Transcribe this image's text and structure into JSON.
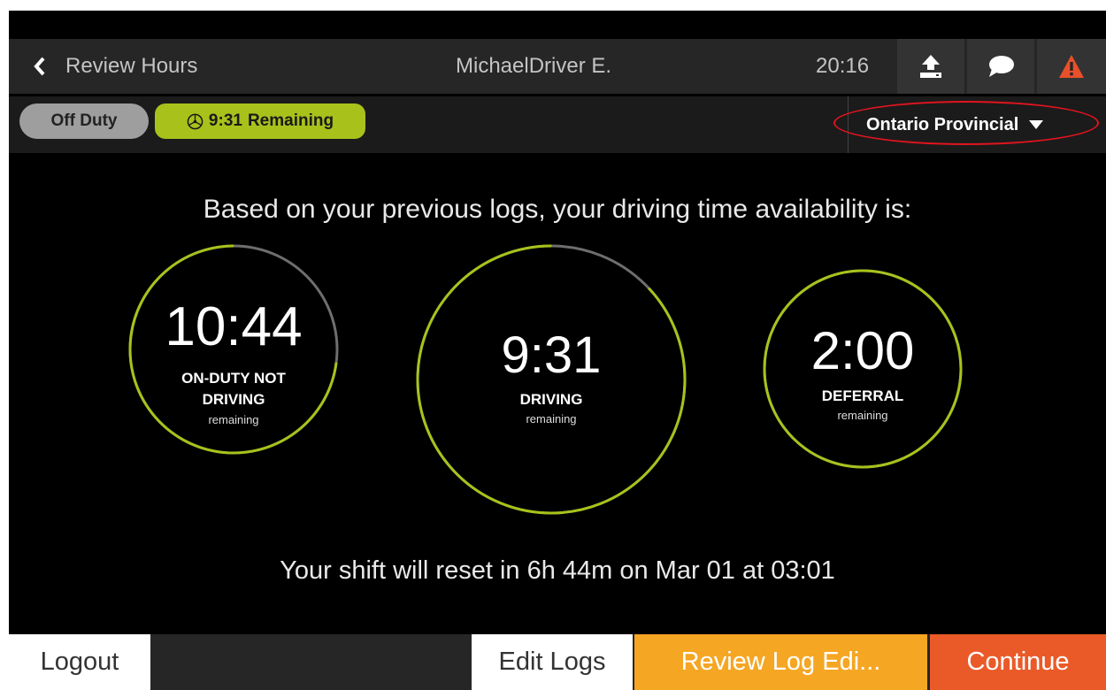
{
  "header": {
    "back_label": "Review Hours",
    "driver_name": "MichaelDriver E.",
    "time": "20:16",
    "icons": [
      "upload-icon",
      "chat-icon",
      "warning-icon"
    ]
  },
  "status": {
    "duty_label": "Off Duty",
    "remaining_time": "9:31",
    "remaining_label": "Remaining",
    "ruleset": "Ontario Provincial"
  },
  "main": {
    "intro": "Based on your previous logs, your driving time availability is:",
    "gauges": [
      {
        "time": "10:44",
        "label_line1": "ON-DUTY NOT",
        "label_line2": "DRIVING",
        "sub": "remaining",
        "remaining_fraction": 0.73
      },
      {
        "time": "9:31",
        "label_line1": "DRIVING",
        "sub": "remaining",
        "remaining_fraction": 0.87
      },
      {
        "time": "2:00",
        "label_line1": "DEFERRAL",
        "sub": "remaining",
        "remaining_fraction": 1.0
      }
    ],
    "reset_text": "Your shift will reset in 6h 44m on Mar 01 at 03:01"
  },
  "footer": {
    "logout": "Logout",
    "edit_logs": "Edit Logs",
    "review_log_edits": "Review Log Edi...",
    "continue": "Continue"
  },
  "colors": {
    "accent": "#a8c21b",
    "track": "#6e6e6e",
    "review": "#f5a623",
    "continue": "#ea5a28",
    "warning": "#e8502a",
    "annotation": "#e0141e"
  }
}
